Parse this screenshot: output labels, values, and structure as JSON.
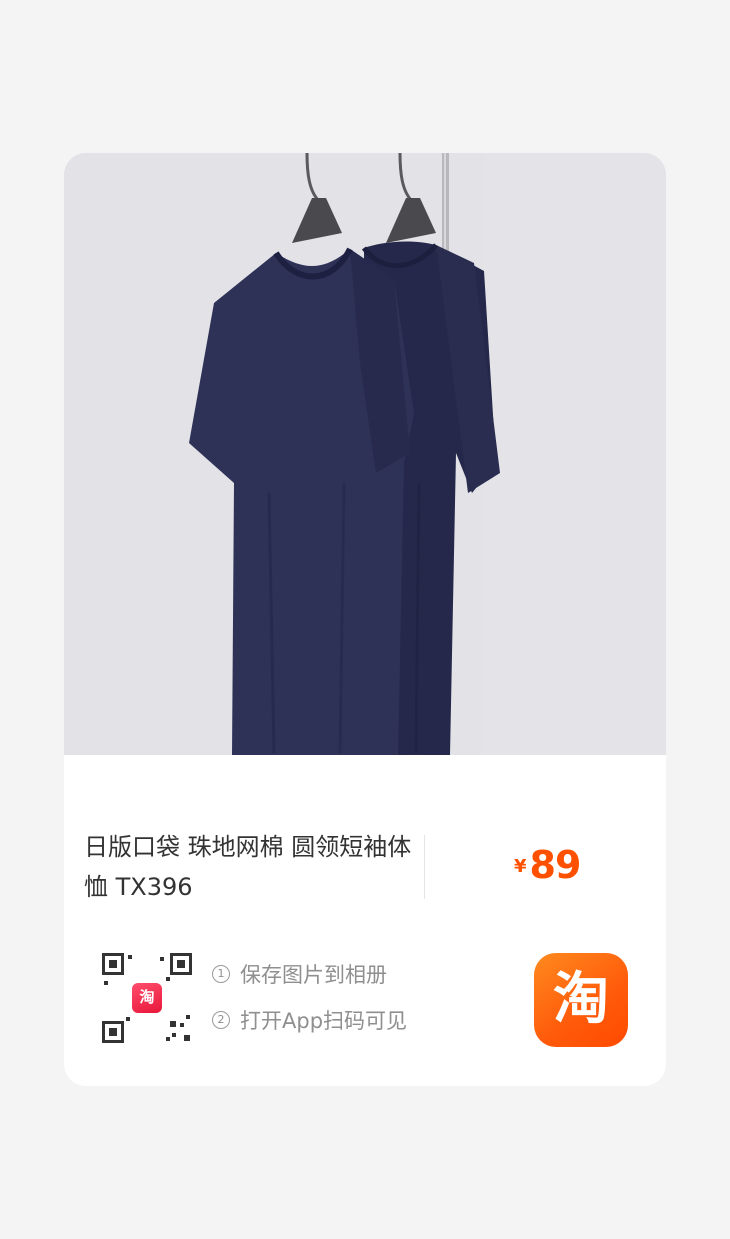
{
  "product": {
    "title": "日版口袋 珠地网棉 圆领短袖体恤 TX396",
    "currency": "¥",
    "price": "89",
    "price_color": "#ff5000"
  },
  "share": {
    "qr_badge_text": "淘",
    "steps": [
      {
        "num": "1",
        "text": "保存图片到相册"
      },
      {
        "num": "2",
        "text": "打开App扫码可见"
      }
    ],
    "app_icon_text": "淘",
    "app_icon_color": "#ff5a0a"
  },
  "image": {
    "subject": "navy t-shirts on hangers",
    "garment_color": "#2b2f52"
  }
}
